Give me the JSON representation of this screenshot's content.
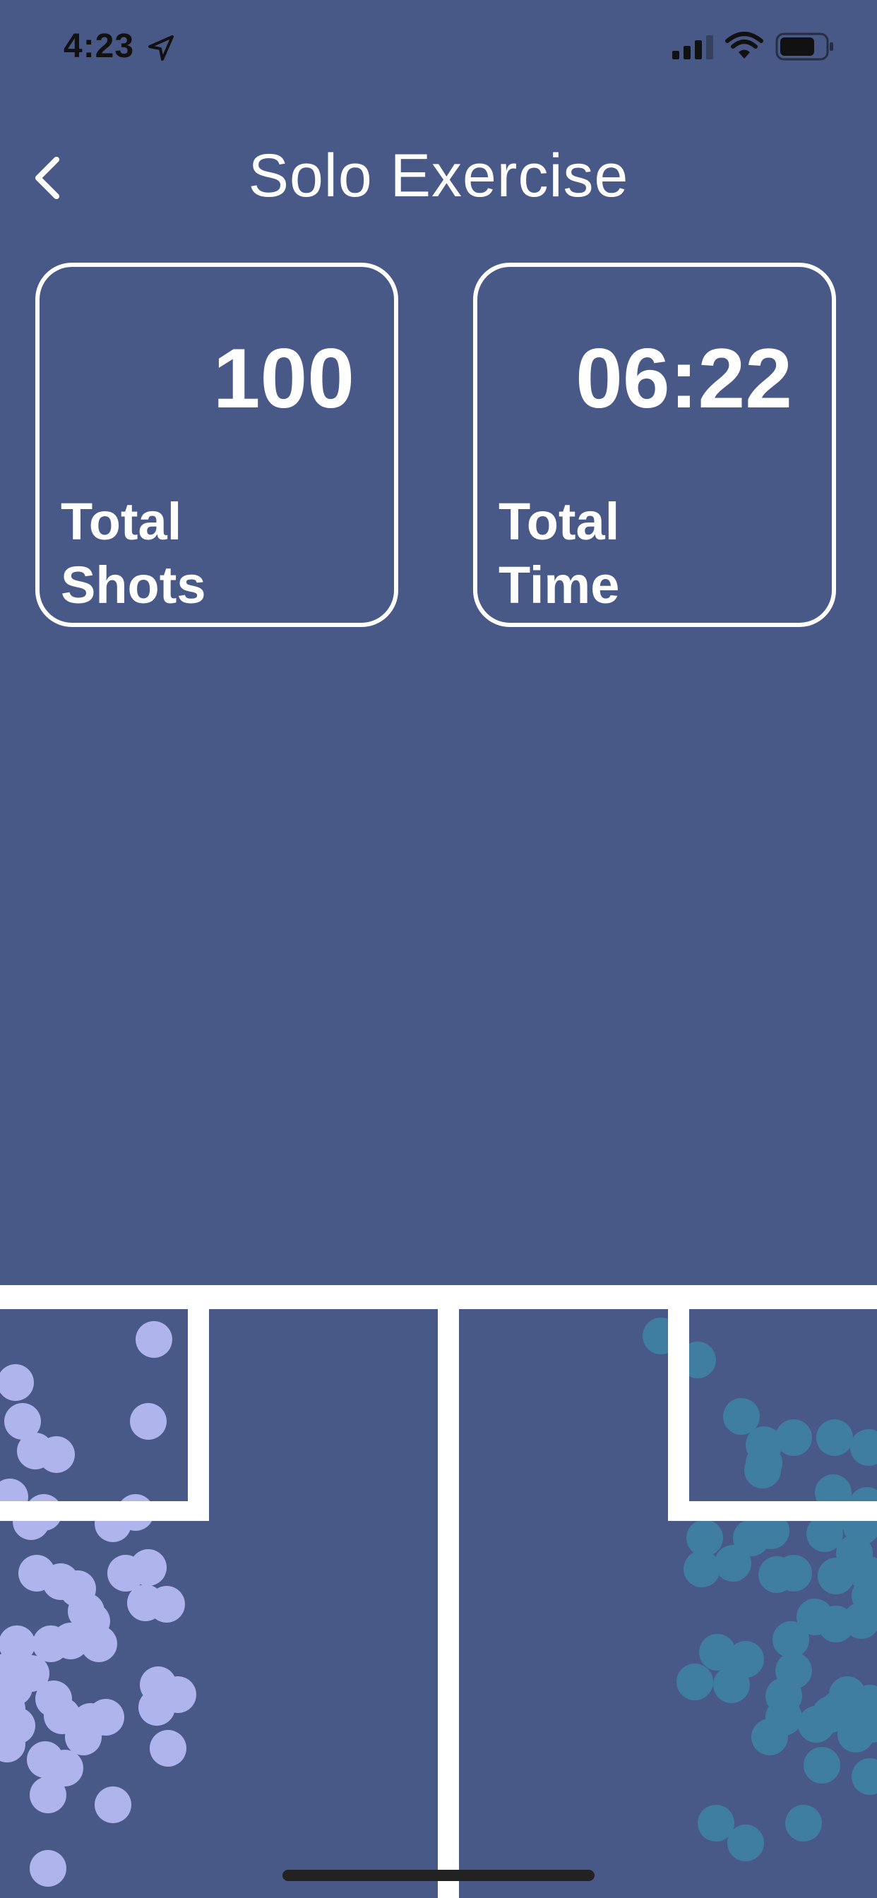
{
  "status_bar": {
    "time": "4:23",
    "location_icon": "location-arrow-icon",
    "signal_icon": "cellular-signal-icon",
    "wifi_icon": "wifi-icon",
    "battery_icon": "battery-icon"
  },
  "header": {
    "title": "Solo Exercise",
    "back_icon": "chevron-left-icon"
  },
  "stats": {
    "total_shots": {
      "value": "100",
      "label_line1": "Total",
      "label_line2": "Shots"
    },
    "total_time": {
      "value": "06:22",
      "label_line1": "Total",
      "label_line2": "Time"
    }
  },
  "colors": {
    "background": "#495987",
    "lines": "#ffffff",
    "left_dots": "#b0b4ec",
    "right_dots": "#3f7da1"
  },
  "court": {
    "left_dots_color": "#b0b4ec",
    "right_dots_color": "#3f7da1"
  }
}
